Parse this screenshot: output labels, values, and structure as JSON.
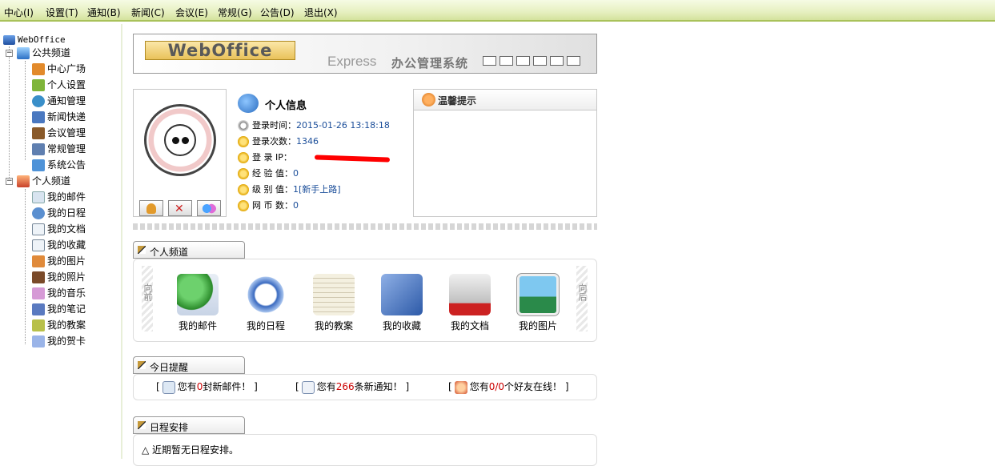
{
  "menu": [
    {
      "label": "中心(I)"
    },
    {
      "label": "设置(T)"
    },
    {
      "label": "通知(B)"
    },
    {
      "label": "新闻(C)"
    },
    {
      "label": "会议(E)"
    },
    {
      "label": "常规(G)"
    },
    {
      "label": "公告(D)"
    },
    {
      "label": "退出(X)"
    }
  ],
  "tree": {
    "root": "WebOffice",
    "public_channel": {
      "label": "公共频道",
      "items": [
        "中心广场",
        "个人设置",
        "通知管理",
        "新闻快递",
        "会议管理",
        "常规管理",
        "系统公告"
      ]
    },
    "personal_channel": {
      "label": "个人频道",
      "items": [
        "我的邮件",
        "我的日程",
        "我的文档",
        "我的收藏",
        "我的图片",
        "我的照片",
        "我的音乐",
        "我的笔记",
        "我的教案",
        "我的贺卡"
      ]
    }
  },
  "logo": {
    "brand": "WebOffice",
    "edition": "Express",
    "system_name": "办公管理系统"
  },
  "personal_info": {
    "title": "个人信息",
    "rows": [
      {
        "label": "登录时间：",
        "value": "2015-01-26 13:18:18"
      },
      {
        "label": "登录次数：",
        "value": "1346"
      },
      {
        "label": "登 录 IP：",
        "value": ""
      },
      {
        "label": "经 验 值：",
        "value": "0"
      },
      {
        "label": "级 别 值：",
        "value": "1[新手上路]"
      },
      {
        "label": "网 币 数：",
        "value": "0"
      }
    ]
  },
  "tips": {
    "title": "温馨提示"
  },
  "personal_section": {
    "title": "个人频道",
    "prev": "向前",
    "next": "向后",
    "apps": [
      "我的邮件",
      "我的日程",
      "我的教案",
      "我的收藏",
      "我的文档",
      "我的图片"
    ]
  },
  "today": {
    "title": "今日提醒",
    "mail": {
      "pre": "您有",
      "count": "0",
      "post": "封新邮件！"
    },
    "notice": {
      "pre": "您有",
      "count": "266",
      "post": "条新通知！"
    },
    "friends": {
      "pre": "您有",
      "count": "0/0",
      "post": "个好友在线！"
    }
  },
  "schedule": {
    "title": "日程安排",
    "empty_text": "△ 近期暂无日程安排。"
  },
  "colors": {
    "menubar": "#e6f0c0",
    "link": "#1a4d99",
    "highlight": "#cc0000"
  }
}
